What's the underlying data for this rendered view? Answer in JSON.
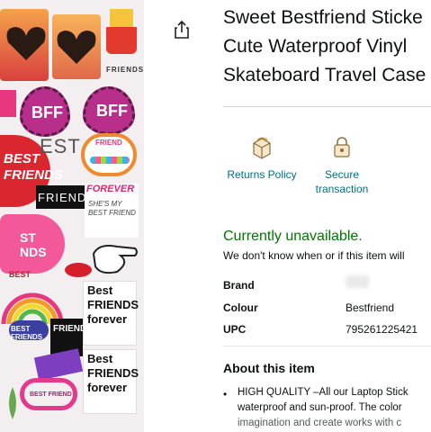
{
  "product": {
    "title_lines": [
      "Sweet Bestfriend Sticke",
      "Cute Waterproof Vinyl",
      "Skateboard Travel Case"
    ],
    "image": {
      "stickers": [
        "BFF",
        "BFF",
        "BEST FRIENDS",
        "FRIENDS",
        "FRIENDS",
        "FRIEND",
        "FOREVER",
        "SHE'S MY BEST FRIEND",
        "Best FRIENDS forever",
        "Best FRIENDS forever",
        "BEST FRIENDS",
        "ST NDS",
        "FRIENDS",
        "BEST",
        "BEST FRIEND"
      ]
    }
  },
  "features": [
    {
      "label_lines": [
        "Returns Policy"
      ],
      "icon": "returns-box-icon"
    },
    {
      "label_lines": [
        "Secure",
        "transaction"
      ],
      "icon": "lock-icon"
    }
  ],
  "availability": {
    "status": "Currently unavailable.",
    "note": "We don't know when or if this item will"
  },
  "specs": {
    "brand_label": "Brand",
    "colour_label": "Colour",
    "colour_value": "Bestfriend",
    "upc_label": "UPC",
    "upc_value": "795261225421"
  },
  "about": {
    "heading": "About this item",
    "bullet_lines": [
      "HIGH QUALITY –All our Laptop Stick",
      "waterproof and sun-proof. The color",
      "imagination and create works with c"
    ]
  },
  "colors": {
    "title": "#0f1111",
    "link": "#007185",
    "available": "#007600",
    "divider": "#d5d9d9"
  }
}
